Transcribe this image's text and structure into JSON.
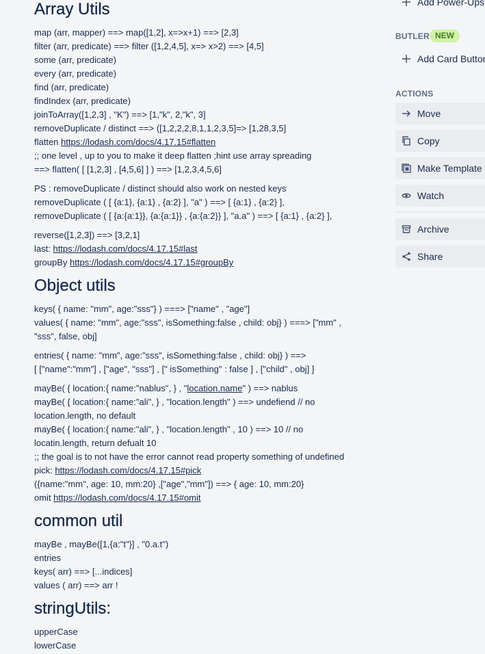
{
  "content": {
    "array_title": "Array Utils",
    "array_lines": [
      "map (arr, mapper) ==> map([1,2], x=>x+1) ==> [2,3]",
      "filter (arr, predicate) ==> filter ([1,2,4,5], x=> x>2) ==> [4,5]",
      "some (arr, predicate)",
      "every (arr, predicate)",
      "find (arr, predicate)",
      "findIndex (arr, predicate)",
      "joinToArray([1,2,3] , \"K\") ==> [1,\"k\", 2,\"k\", 3]",
      "removeDuplicate / distinct ==> ([1,2,2,2,8,1,1,2,3,5]=> [1,28,3,5]",
      "flatten ",
      ";; one level , up to you to make it deep flatten ;hint use array spreading",
      "==> flatten( [ [1,2,3] , [4,5,6] ] ) ==> [1,2,3,4,5,6]",
      "PS : removeDuplicate / distinct should also work on nested keys",
      "removeDuplicate ( [ {a:1}, {a:1} , {a:2} ], \"a\" ) ==> [ {a:1} , {a:2} ],",
      "removeDuplicate ( [ {a:{a:1}}, {a:{a:1}} , {a:{a:2}} ], \"a.a\" ) ==> [ {a:1} , {a:2} ],",
      "reverse([1,2,3]) ==> [3,2,1]",
      "last: ",
      "groupBy "
    ],
    "links": {
      "flatten": "https://lodash.com/docs/4.17.15#flatten",
      "last": "https://lodash.com/docs/4.17.15#last",
      "groupBy": "https://lodash.com/docs/4.17.15#groupBy",
      "pick": "https://lodash.com/docs/4.17.15#pick",
      "omit": "https://lodash.com/docs/4.17.15#omit",
      "location_name": "location.name"
    },
    "object_title": "Object utils",
    "object_lines": [
      "keys( { name: \"mm\", age:\"sss\"} ) ===> [\"name\" , \"age\"]",
      "values( { name: \"mm\", age:\"sss\", isSomething:false , child: obj} ) ===> [\"mm\" ,",
      "\"sss\", false, obj]",
      "entries( { name: \"mm\", age:\"sss\", isSomething:false , child: obj} ) ==>",
      "[ [\"name\":\"mm\"] , [\"age\", \"sss\"] , [\" isSomething\" : false ] , [\"child\" , obj] ]",
      "mayBe( { location:{ name:\"nablus\", } , \"",
      "\" ) ==> nablus",
      "mayBe( { location:{ name:\"ali\", } , \"location.length\" ) ==> undefiend // no",
      "location.length, no default",
      "mayBe( { location:{ name:\"ali\", } , \"location.length\" , 10 ) ==> 10 // no",
      "locatin.length, return defualt 10",
      ";; the goal is to not have the error cannot read property something of undefined",
      "pick: ",
      "({name:\"mm\", age: 10, mm:20} ,[\"age\",\"mm\"]) ==> { age: 10, mm:20}",
      "omit "
    ],
    "common_title": "common util",
    "common_lines": [
      "mayBe , mayBe([1,{a:\"t\"}] , \"0.a.t\")",
      "entries",
      "keys( arr) ==> [...indices]",
      "values ( arr) ==> arr !"
    ],
    "string_title": "stringUtils:",
    "string_lines": [
      "upperCase",
      "lowerCase"
    ]
  },
  "sidebar": {
    "add_powerups": "Add Power-Ups",
    "butler_title": "BUTLER",
    "butler_badge": "NEW",
    "add_card_button": "Add Card Button",
    "actions_title": "ACTIONS",
    "actions": [
      {
        "label": "Move",
        "icon": "arrow-right-icon"
      },
      {
        "label": "Copy",
        "icon": "copy-icon"
      },
      {
        "label": "Make Template",
        "icon": "template-icon"
      },
      {
        "label": "Watch",
        "icon": "eye-icon"
      },
      {
        "label": "Archive",
        "icon": "archive-icon"
      },
      {
        "label": "Share",
        "icon": "share-icon"
      }
    ]
  }
}
